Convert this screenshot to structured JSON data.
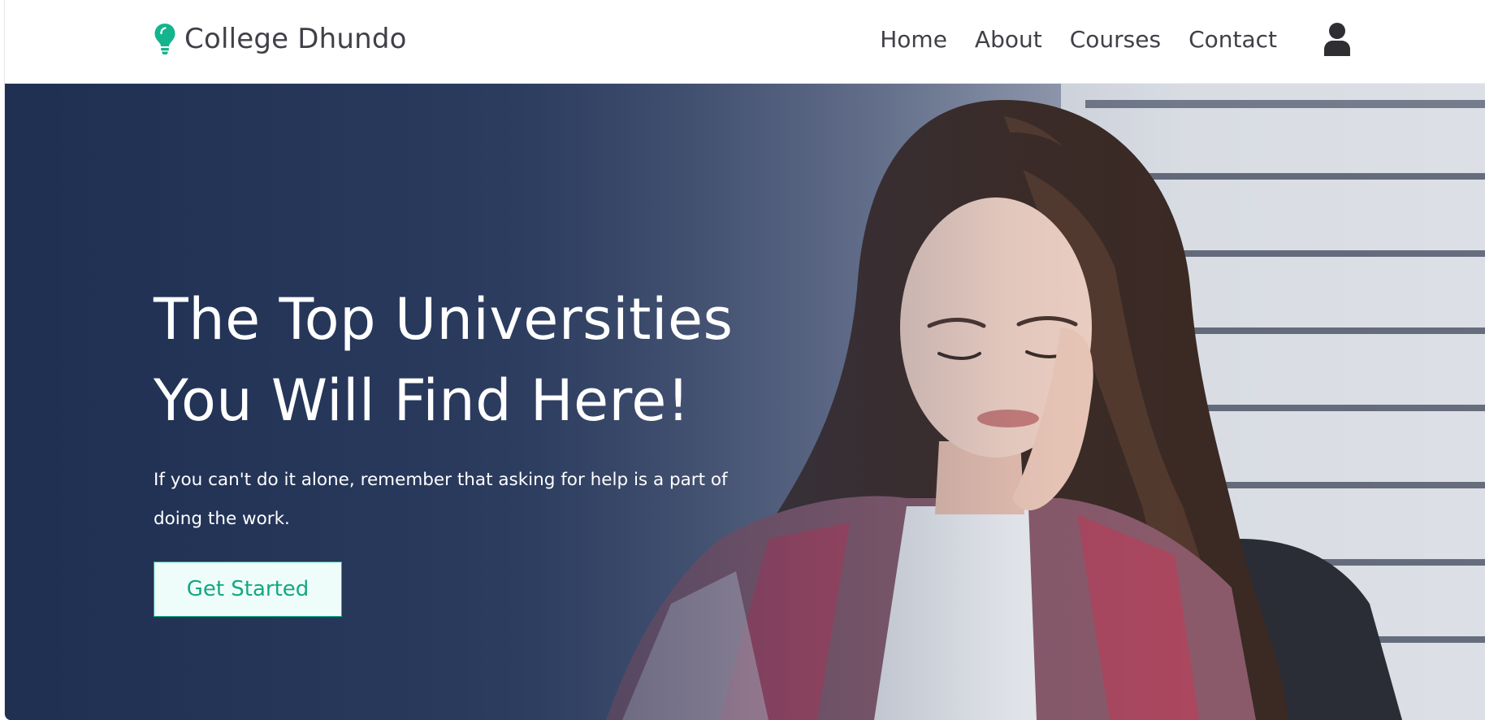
{
  "brand": {
    "name": "College Dhundo",
    "icon": "lightbulb-icon",
    "icon_color": "#13b58c"
  },
  "nav": {
    "items": [
      {
        "label": "Home"
      },
      {
        "label": "About"
      },
      {
        "label": "Courses"
      },
      {
        "label": "Contact"
      }
    ],
    "user_icon": "user-icon"
  },
  "hero": {
    "title_line1": "The Top Universities",
    "title_line2": "You Will Find Here!",
    "subtitle": "If you can't do it alone, remember that asking for help is a part of doing the work.",
    "cta_label": "Get Started"
  },
  "colors": {
    "accent": "#13b58c",
    "nav_text": "#404048",
    "cta_bg": "#effdfa"
  }
}
